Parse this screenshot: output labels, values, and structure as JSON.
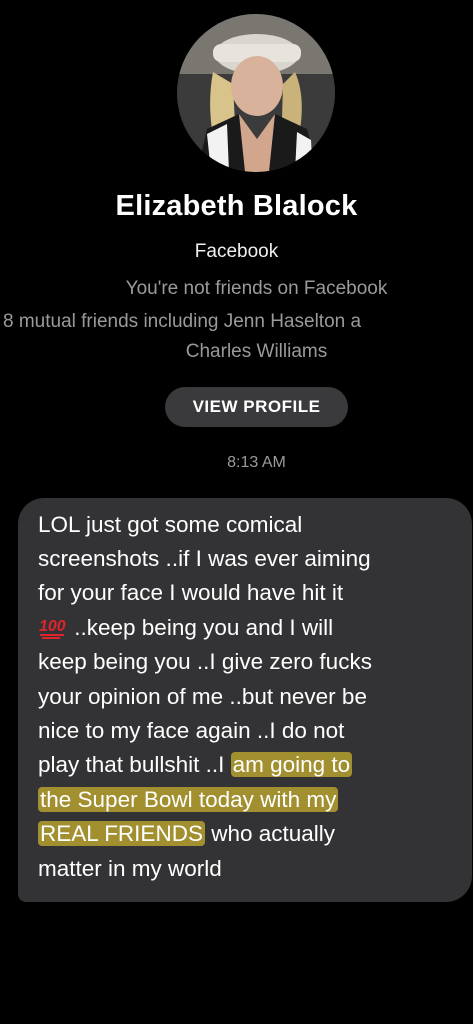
{
  "profile": {
    "name": "Elizabeth Blalock",
    "platform": "Facebook",
    "friend_status": "You're not friends on Facebook",
    "mutual_friends_line1": "8 mutual friends including Jenn Haselton a",
    "mutual_friends_line2": "Charles Williams",
    "view_profile_label": "VIEW PROFILE"
  },
  "conversation": {
    "timestamp": "8:13 AM",
    "message": {
      "line1": "LOL just got some comical",
      "line2": "screenshots ..if I was ever aiming",
      "line3": "for your face I would have hit it",
      "line4_emoji": "hundred-points-emoji",
      "line4": " ..keep being you and I will",
      "line5": "keep being you ..I give zero fucks",
      "line6": "your opinion of me ..but never be",
      "line7": "nice to my face again  ..I do not",
      "line8_a": "play that bullshit ..I ",
      "line8_b": "am going to",
      "line9": "the Super Bowl today with my",
      "line10_a": "REAL FRIENDS",
      "line10_b": " who actually",
      "line11": "matter in my world",
      "highlight_color": "#c8af2d"
    }
  },
  "colors": {
    "background": "#000000",
    "bubble": "#333335",
    "secondary_text": "#9a9a9a",
    "button_bg": "#3a3a3c"
  }
}
